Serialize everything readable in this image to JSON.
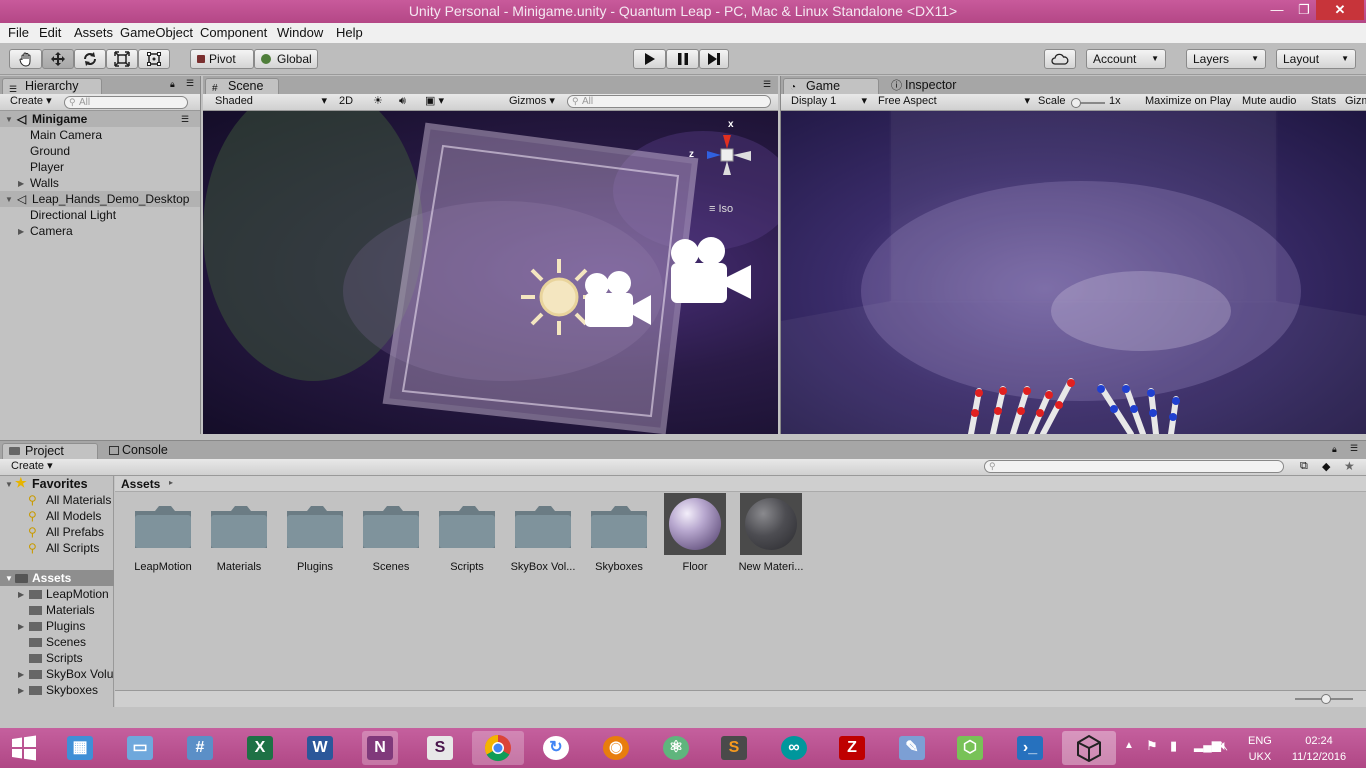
{
  "window": {
    "title": "Unity Personal - Minigame.unity - Quantum Leap - PC, Mac & Linux Standalone <DX11>",
    "minimize": "—",
    "maximize": "❐",
    "close": "✕"
  },
  "menubar": {
    "items": [
      "File",
      "Edit",
      "Assets",
      "GameObject",
      "Component",
      "Window",
      "Help"
    ]
  },
  "toolbar": {
    "pivot_label": "Pivot",
    "global_label": "Global",
    "account_label": "Account",
    "layers_label": "Layers",
    "layout_label": "Layout"
  },
  "hierarchy": {
    "tab_label": "Hierarchy",
    "create_label": "Create",
    "search_placeholder": "All",
    "rows": [
      {
        "label": "Minigame",
        "kind": "scene"
      },
      {
        "label": "Main Camera",
        "kind": "child"
      },
      {
        "label": "Ground",
        "kind": "child"
      },
      {
        "label": "Player",
        "kind": "child"
      },
      {
        "label": "Walls",
        "kind": "child-collapsed"
      },
      {
        "label": "Leap_Hands_Demo_Desktop",
        "kind": "scene"
      },
      {
        "label": "Directional Light",
        "kind": "child"
      },
      {
        "label": "Camera",
        "kind": "child-collapsed"
      }
    ]
  },
  "scene": {
    "tab_label": "Scene",
    "shading_mode": "Shaded",
    "mode_2d": "2D",
    "gizmos_label": "Gizmos",
    "search_placeholder": "All",
    "gizmo_x": "x",
    "gizmo_z": "z",
    "projection_label": "Iso"
  },
  "game": {
    "tab_label": "Game",
    "display": "Display 1",
    "aspect": "Free Aspect",
    "scale_label": "Scale",
    "scale_value": "1x",
    "maximize_label": "Maximize on Play",
    "mute_label": "Mute audio",
    "stats_label": "Stats",
    "gizmos_label": "Gizm"
  },
  "inspector": {
    "tab_label": "Inspector"
  },
  "project": {
    "tab_label": "Project",
    "console_label": "Console",
    "create_label": "Create",
    "favorites_label": "Favorites",
    "favorites": [
      "All Materials",
      "All Models",
      "All Prefabs",
      "All Scripts"
    ],
    "assets_label": "Assets",
    "asset_folders": [
      "LeapMotion",
      "Materials",
      "Plugins",
      "Scenes",
      "Scripts",
      "SkyBox Volu",
      "Skyboxes"
    ],
    "breadcrumb": "Assets",
    "grid_items": [
      {
        "label": "LeapMotion",
        "type": "folder"
      },
      {
        "label": "Materials",
        "type": "folder"
      },
      {
        "label": "Plugins",
        "type": "folder"
      },
      {
        "label": "Scenes",
        "type": "folder"
      },
      {
        "label": "Scripts",
        "type": "folder"
      },
      {
        "label": "SkyBox Vol...",
        "type": "folder"
      },
      {
        "label": "Skyboxes",
        "type": "folder"
      },
      {
        "label": "Floor",
        "type": "material-light"
      },
      {
        "label": "New Materi...",
        "type": "material-dark"
      }
    ]
  },
  "taskbar": {
    "apps": [
      "windows-start",
      "control-panel",
      "this-pc",
      "calculator",
      "excel",
      "word",
      "onenote",
      "slack",
      "chrome",
      "google-photos",
      "blender",
      "atom",
      "sublime-text",
      "arduino",
      "filezilla",
      "paint",
      "android-studio",
      "powershell",
      "unity"
    ],
    "language": "ENG",
    "layout": "UKX",
    "time": "02:24",
    "date": "11/12/2016"
  }
}
